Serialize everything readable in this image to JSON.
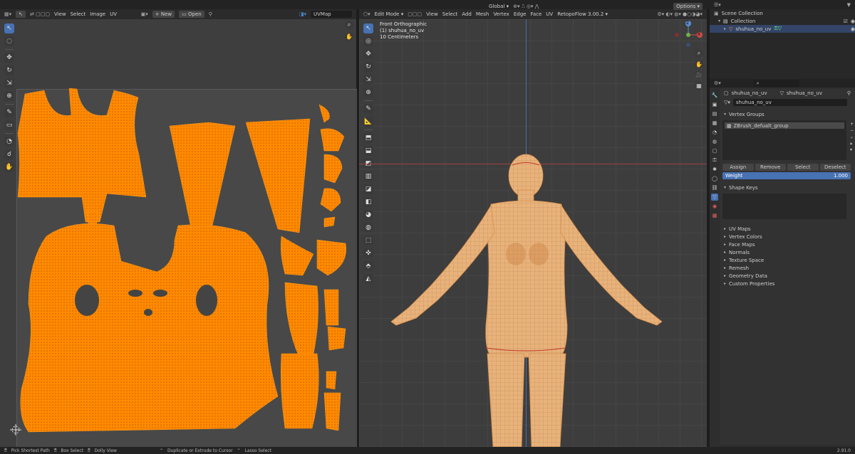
{
  "uv_editor": {
    "menus": [
      "View",
      "Select",
      "Image",
      "UV"
    ],
    "new_label": "New",
    "open_label": "Open",
    "uvmap_field": "UVMap"
  },
  "viewport": {
    "mode": "Edit Mode",
    "menus": [
      "View",
      "Select",
      "Add",
      "Mesh",
      "Vertex",
      "Edge",
      "Face",
      "UV"
    ],
    "addon": "RetopoFlow 3.00.2",
    "orientation": "Global",
    "options_label": "Options",
    "overlay_view": "Front Orthographic",
    "overlay_object": "(1) shuhua_no_uv",
    "overlay_scale": "10 Centimeters",
    "gizmo": {
      "x": "X",
      "y": "Y",
      "z": "Z"
    }
  },
  "outliner": {
    "scene_collection": "Scene Collection",
    "collection": "Collection",
    "object": "shuhua_no_uv"
  },
  "properties": {
    "breadcrumb_object": "shuhua_no_uv",
    "breadcrumb_mesh": "shuhua_no_uv",
    "mesh_name": "shuhua_no_uv",
    "vertex_groups_title": "Vertex Groups",
    "vertex_group_item": "ZBrush_defualt_group",
    "assign": "Assign",
    "remove": "Remove",
    "select": "Select",
    "deselect": "Deselect",
    "weight_label": "Weight",
    "weight_value": "1.000",
    "shape_keys_title": "Shape Keys",
    "collapsed_panels": [
      "UV Maps",
      "Vertex Colors",
      "Face Maps",
      "Normals",
      "Texture Space",
      "Remesh",
      "Geometry Data",
      "Custom Properties"
    ]
  },
  "status_bar": {
    "items": [
      "Pick Shortest Path",
      "Box Select",
      "Dolly View",
      "Duplicate or Extrude to Cursor",
      "Lasso Select"
    ],
    "version": "2.91.0"
  },
  "colors": {
    "uv_orange": "#ff8a00",
    "skin": "#e8b27a",
    "viewport_bg": "#3d3d3d",
    "uv_bg": "#444444",
    "accent_blue": "#4772b3"
  }
}
